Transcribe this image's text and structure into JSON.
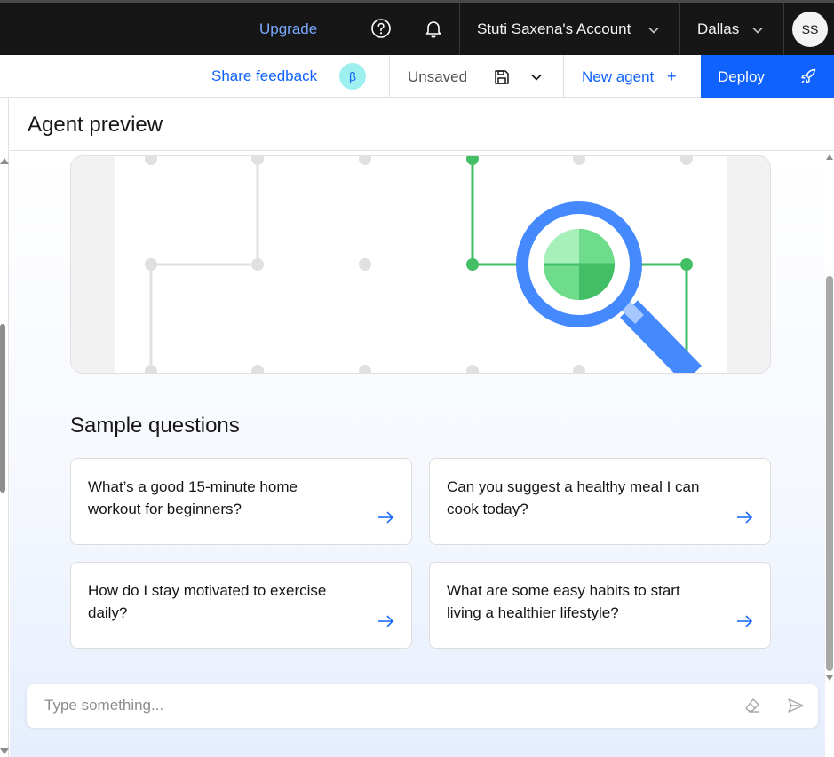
{
  "topbar": {
    "upgrade_label": "Upgrade",
    "account_label": "Stuti Saxena's Account",
    "region_label": "Dallas",
    "avatar_initials": "SS",
    "help_icon": "help-icon",
    "notification_icon": "bell-icon"
  },
  "toolbar": {
    "feedback_label": "Share feedback",
    "beta_badge": "β",
    "save_status": "Unsaved",
    "new_agent_label": "New agent",
    "new_agent_plus": "+",
    "deploy_label": "Deploy"
  },
  "panel": {
    "title": "Agent preview"
  },
  "sample_questions": {
    "title": "Sample questions",
    "items": [
      {
        "text": "What’s a good 15-minute home workout for beginners?"
      },
      {
        "text": "Can you suggest a healthy meal I can cook today?"
      },
      {
        "text": "How do I stay motivated to exercise daily?"
      },
      {
        "text": "What are some easy habits to start living a healthier lifestyle?"
      }
    ]
  },
  "chat_input": {
    "placeholder": "Type something..."
  },
  "colors": {
    "brand_blue": "#0f62fe",
    "link_blue": "#78a9ff",
    "header_black": "#161616",
    "illustration_green": "#42be65",
    "illustration_blue": "#4589ff"
  }
}
